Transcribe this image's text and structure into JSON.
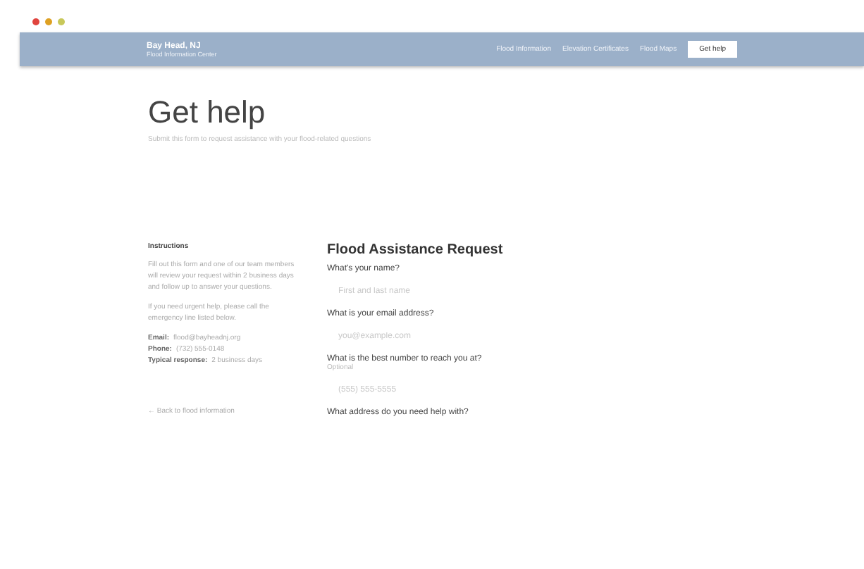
{
  "window": {
    "controls": [
      {
        "color": "#e0443e"
      },
      {
        "color": "#dea123"
      },
      {
        "color": "#c8c85a"
      }
    ]
  },
  "nav": {
    "brand": "Bay Head, NJ",
    "tagline": "Flood Information Center",
    "links": [
      "Flood Information",
      "Elevation Certificates",
      "Flood Maps"
    ],
    "button": "Get help"
  },
  "header": {
    "title": "Get help",
    "subtitle": "Submit this form to request assistance with your flood-related questions"
  },
  "sidebar": {
    "heading": "Instructions",
    "paragraphs": [
      "Fill out this form and one of our team members will review your request within 2 business days and follow up to answer your questions.",
      "If you need urgent help, please call the emergency line listed below."
    ],
    "details": [
      {
        "label": "Email:",
        "value": "flood@bayheadnj.org"
      },
      {
        "label": "Phone:",
        "value": "(732) 555-0148"
      },
      {
        "label": "Typical response:",
        "value": "2 business days"
      }
    ],
    "link": "← Back to flood information"
  },
  "form": {
    "title": "Flood Assistance Request",
    "fields": [
      {
        "label": "What's your name?",
        "placeholder": "First and last name"
      },
      {
        "label": "What is your email address?",
        "placeholder": "you@example.com"
      },
      {
        "label": "What is the best number to reach you at?",
        "hint": "Optional",
        "placeholder": "(555) 555-5555"
      },
      {
        "label": "What address do you need help with?"
      }
    ]
  }
}
